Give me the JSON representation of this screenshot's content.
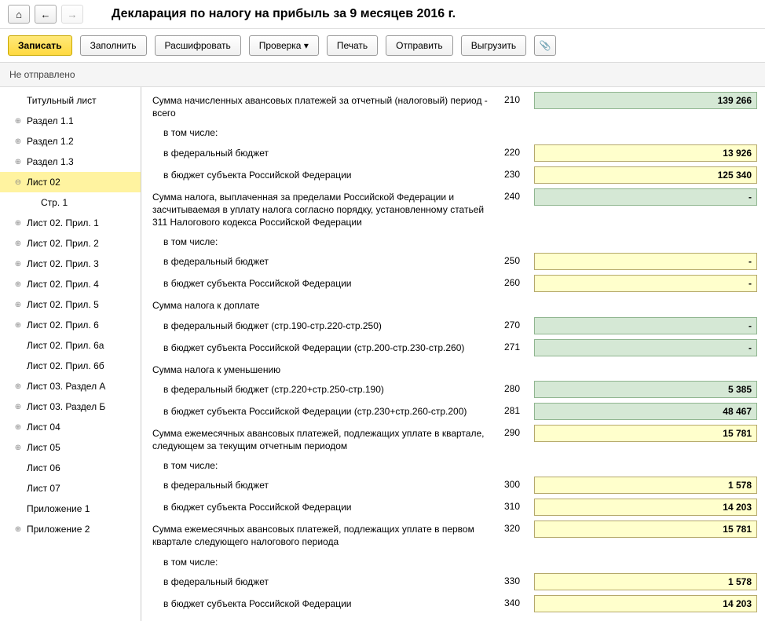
{
  "header": {
    "title": "Декларация по налогу на прибыль за 9 месяцев 2016 г."
  },
  "toolbar": {
    "write": "Записать",
    "fill": "Заполнить",
    "decrypt": "Расшифровать",
    "check": "Проверка",
    "print": "Печать",
    "send": "Отправить",
    "export": "Выгрузить"
  },
  "status": "Не отправлено",
  "sidebar": {
    "items": [
      {
        "label": "Титульный лист",
        "lvl": 1,
        "exp": ""
      },
      {
        "label": "Раздел 1.1",
        "lvl": 1,
        "exp": "+"
      },
      {
        "label": "Раздел 1.2",
        "lvl": 1,
        "exp": "+"
      },
      {
        "label": "Раздел 1.3",
        "lvl": 1,
        "exp": "+"
      },
      {
        "label": "Лист 02",
        "lvl": 1,
        "exp": "−",
        "sel": true
      },
      {
        "label": "Стр. 1",
        "lvl": 2,
        "exp": ""
      },
      {
        "label": "Лист 02. Прил. 1",
        "lvl": 1,
        "exp": "+"
      },
      {
        "label": "Лист 02. Прил. 2",
        "lvl": 1,
        "exp": "+"
      },
      {
        "label": "Лист 02. Прил. 3",
        "lvl": 1,
        "exp": "+"
      },
      {
        "label": "Лист 02. Прил. 4",
        "lvl": 1,
        "exp": "+"
      },
      {
        "label": "Лист 02. Прил. 5",
        "lvl": 1,
        "exp": "+"
      },
      {
        "label": "Лист 02. Прил. 6",
        "lvl": 1,
        "exp": "+"
      },
      {
        "label": "Лист 02. Прил. 6а",
        "lvl": 1,
        "exp": ""
      },
      {
        "label": "Лист 02. Прил. 6б",
        "lvl": 1,
        "exp": ""
      },
      {
        "label": "Лист 03. Раздел А",
        "lvl": 1,
        "exp": "+"
      },
      {
        "label": "Лист 03. Раздел Б",
        "lvl": 1,
        "exp": "+"
      },
      {
        "label": "Лист 04",
        "lvl": 1,
        "exp": "+"
      },
      {
        "label": "Лист 05",
        "lvl": 1,
        "exp": "+"
      },
      {
        "label": "Лист 06",
        "lvl": 1,
        "exp": ""
      },
      {
        "label": "Лист 07",
        "lvl": 1,
        "exp": ""
      },
      {
        "label": "Приложение 1",
        "lvl": 1,
        "exp": ""
      },
      {
        "label": "Приложение 2",
        "lvl": 1,
        "exp": "+"
      }
    ]
  },
  "form": {
    "rows": [
      {
        "label": "Сумма начисленных авансовых платежей за отчетный (налоговый) период - всего",
        "code": "210",
        "value": "139 266",
        "color": "green",
        "indent": 0
      },
      {
        "label": "в том числе:",
        "section": true,
        "indent": 1
      },
      {
        "label": "в федеральный бюджет",
        "code": "220",
        "value": "13 926",
        "color": "yellow",
        "indent": 1
      },
      {
        "label": "в бюджет субъекта Российской Федерации",
        "code": "230",
        "value": "125 340",
        "color": "yellow",
        "indent": 1
      },
      {
        "label": "Сумма налога, выплаченная за пределами Российской Федерации и засчитываемая в уплату налога согласно порядку, установленному статьей 311 Налогового кодекса Российской Федерации",
        "code": "240",
        "value": "-",
        "color": "green",
        "indent": 0
      },
      {
        "label": "в том числе:",
        "section": true,
        "indent": 1
      },
      {
        "label": "в федеральный бюджет",
        "code": "250",
        "value": "-",
        "color": "yellow",
        "indent": 1
      },
      {
        "label": "в бюджет субъекта Российской Федерации",
        "code": "260",
        "value": "-",
        "color": "yellow",
        "indent": 1
      },
      {
        "label": "Сумма налога к доплате",
        "section": true,
        "indent": 0
      },
      {
        "label": "в федеральный бюджет (стр.190-стр.220-стр.250)",
        "code": "270",
        "value": "-",
        "color": "green",
        "indent": 1
      },
      {
        "label": "в бюджет субъекта Российской Федерации (стр.200-стр.230-стр.260)",
        "code": "271",
        "value": "-",
        "color": "green",
        "indent": 1
      },
      {
        "label": "Сумма налога к уменьшению",
        "section": true,
        "indent": 0
      },
      {
        "label": "в федеральный бюджет (стр.220+стр.250-стр.190)",
        "code": "280",
        "value": "5 385",
        "color": "green",
        "indent": 1
      },
      {
        "label": "в бюджет субъекта Российской Федерации (стр.230+стр.260-стр.200)",
        "code": "281",
        "value": "48 467",
        "color": "green",
        "indent": 1
      },
      {
        "label": "Сумма ежемесячных авансовых платежей, подлежащих уплате в квартале, следующем за текущим отчетным периодом",
        "code": "290",
        "value": "15 781",
        "color": "yellow",
        "indent": 0
      },
      {
        "label": "в том числе:",
        "section": true,
        "indent": 1
      },
      {
        "label": "в федеральный бюджет",
        "code": "300",
        "value": "1 578",
        "color": "yellow",
        "indent": 1
      },
      {
        "label": "в бюджет субъекта Российской Федерации",
        "code": "310",
        "value": "14 203",
        "color": "yellow",
        "indent": 1
      },
      {
        "label": "Сумма ежемесячных авансовых платежей, подлежащих уплате в первом квартале следующего налогового периода",
        "code": "320",
        "value": "15 781",
        "color": "yellow",
        "indent": 0
      },
      {
        "label": "в том числе:",
        "section": true,
        "indent": 1
      },
      {
        "label": "в федеральный бюджет",
        "code": "330",
        "value": "1 578",
        "color": "yellow",
        "indent": 1
      },
      {
        "label": "в бюджет субъекта Российской Федерации",
        "code": "340",
        "value": "14 203",
        "color": "yellow",
        "indent": 1
      }
    ]
  }
}
